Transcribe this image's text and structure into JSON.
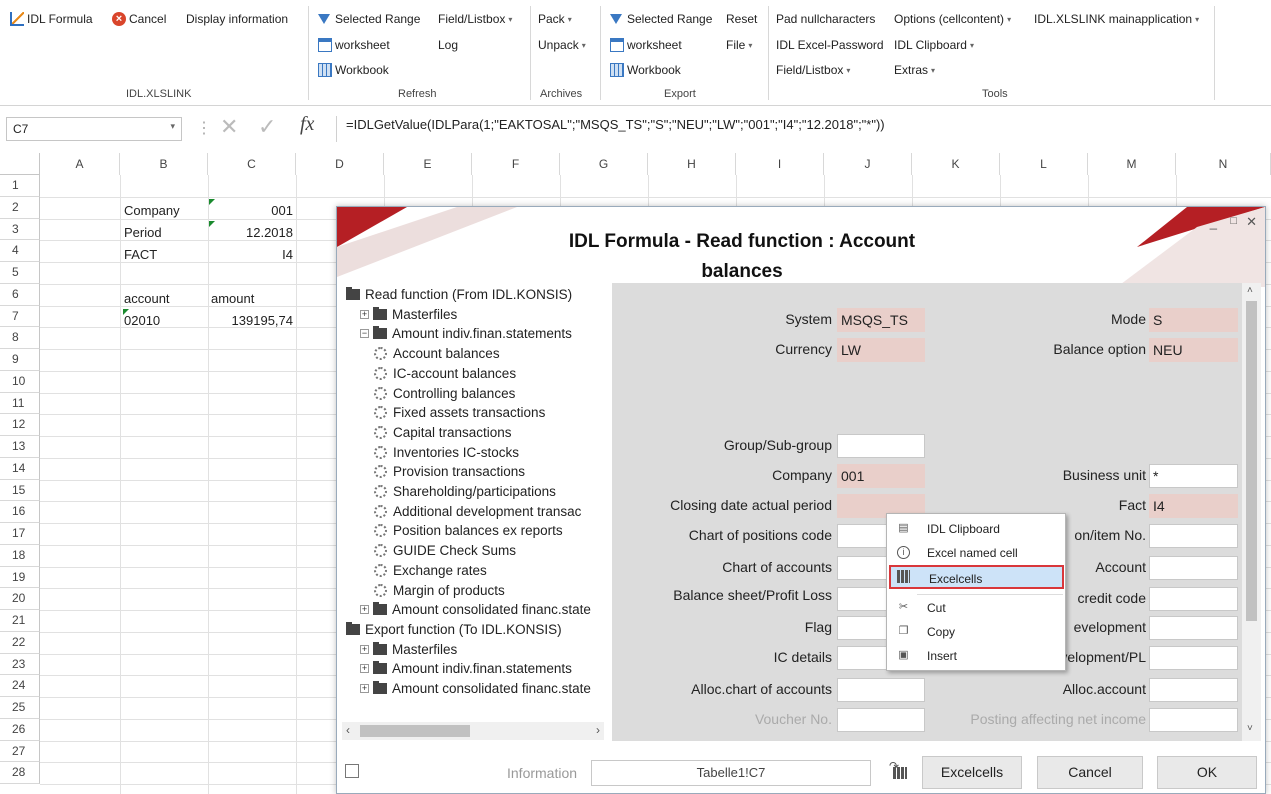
{
  "ribbon": {
    "xlslink": {
      "idl_formula": "IDL Formula",
      "cancel": "Cancel",
      "display_information": "Display information",
      "group_label": "IDL.XLSLINK"
    },
    "refresh": {
      "selected_range": "Selected Range",
      "field_listbox": "Field/Listbox",
      "worksheet": "worksheet",
      "log": "Log",
      "workbook": "Workbook",
      "group_label": "Refresh"
    },
    "archives": {
      "pack": "Pack",
      "unpack": "Unpack",
      "group_label": "Archives"
    },
    "export": {
      "selected_range": "Selected Range",
      "reset": "Reset",
      "worksheet": "worksheet",
      "file": "File",
      "workbook": "Workbook",
      "group_label": "Export"
    },
    "tools": {
      "pad_null": "Pad nullcharacters",
      "options_cellcontent": "Options (cellcontent)",
      "xlslink_main": "IDL.XLSLINK mainapplication",
      "excel_password": "IDL Excel-Password",
      "idl_clipboard": "IDL Clipboard",
      "field_listbox": "Field/Listbox",
      "extras": "Extras",
      "group_label": "Tools"
    }
  },
  "formula_bar": {
    "name_box": "C7",
    "fx": "fx",
    "formula": "=IDLGetValue(IDLPara(1;\"EAKTOSAL\";\"MSQS_TS\";\"S\";\"NEU\";\"LW\";\"001\";\"I4\";\"12.2018\";\"*\"))"
  },
  "grid": {
    "columns": [
      "A",
      "B",
      "C",
      "D",
      "E",
      "F",
      "G",
      "H",
      "I",
      "J",
      "K",
      "L",
      "M",
      "N"
    ],
    "rows": [
      "1",
      "2",
      "3",
      "4",
      "5",
      "6",
      "7",
      "8",
      "9",
      "10",
      "11",
      "12",
      "13",
      "14",
      "15",
      "16",
      "17",
      "18",
      "19",
      "20",
      "21",
      "22",
      "23",
      "24",
      "25",
      "26",
      "27",
      "28"
    ],
    "b2": "Company",
    "c2": "001",
    "b3": "Period",
    "c3": "12.2018",
    "b4": "FACT",
    "c4": "I4",
    "b6": "account",
    "c6": "amount",
    "b7": "02010",
    "c7": "139195,74"
  },
  "dialog": {
    "title_line1": "IDL Formula - Read function : Account",
    "title_line2": "balances",
    "tree": [
      "Read function (From IDL.KONSIS)",
      "Masterfiles",
      "Amount indiv.finan.statements",
      "Account balances",
      "IC-account balances",
      "Controlling balances",
      "Fixed assets transactions",
      "Capital transactions",
      "Inventories IC-stocks",
      "Provision transactions",
      "Shareholding/participations",
      "Additional development transac",
      "Position balances ex reports",
      "GUIDE Check Sums",
      "Exchange rates",
      "Margin of products",
      "Amount consolidated financ.state",
      "Export function (To IDL.KONSIS)",
      "Masterfiles",
      "Amount indiv.finan.statements",
      "Amount consolidated financ.state"
    ],
    "fields": {
      "system_label": "System",
      "system_value": "MSQS_TS",
      "mode_label": "Mode",
      "mode_value": "S",
      "currency_label": "Currency",
      "currency_value": "LW",
      "balance_option_label": "Balance option",
      "balance_option_value": "NEU",
      "group_label": "Group/Sub-group",
      "company_label": "Company",
      "company_value": "001",
      "business_unit_label": "Business unit",
      "business_unit_value": "*",
      "closing_label": "Closing date actual period",
      "fact_label": "Fact",
      "fact_value": "I4",
      "chart_positions_label": "Chart of positions code",
      "position_item_label": "on/item No.",
      "chart_accounts_label": "Chart of accounts",
      "account_label": "Account",
      "bs_pl_label": "Balance sheet/Profit  Loss",
      "credit_code_label": "credit code",
      "flag_label": "Flag",
      "development_label": "evelopment",
      "ic_details_label": "IC details",
      "transaction_dev_label": "Transaction development/PL",
      "alloc_chart_label": "Alloc.chart of accounts",
      "alloc_account_label": "Alloc.account",
      "voucher_label": "Voucher No.",
      "posting_label": "Posting affecting net income"
    },
    "footer": {
      "information_label": "Information",
      "information_value": "Tabelle1!C7",
      "excelcells": "Excelcells",
      "cancel": "Cancel",
      "ok": "OK"
    }
  },
  "context_menu": {
    "items": [
      "IDL Clipboard",
      "Excel named cell",
      "Excelcells",
      "Cut",
      "Copy",
      "Insert"
    ],
    "selected": "Excelcells"
  }
}
